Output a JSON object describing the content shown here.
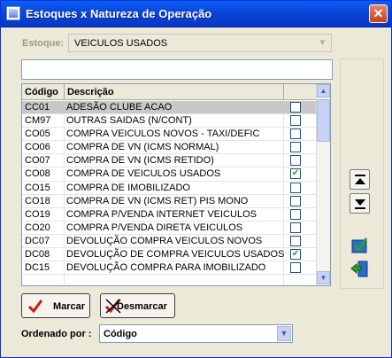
{
  "window": {
    "title": "Estoques x Natureza de Operação",
    "close_label": "✕"
  },
  "estoque": {
    "label": "Estoque:",
    "value": "VEICULOS USADOS"
  },
  "filter": {
    "value": ""
  },
  "grid": {
    "headers": [
      "Código",
      "Descrição"
    ],
    "rows": [
      {
        "code": "CC01",
        "desc": "ADESÃO CLUBE ACAO",
        "checked": false,
        "selected": true
      },
      {
        "code": "CM97",
        "desc": "OUTRAS SAIDAS (N/CONT)",
        "checked": false
      },
      {
        "code": "CO05",
        "desc": "COMPRA  VEICULOS NOVOS - TAXI/DEFIC",
        "checked": false
      },
      {
        "code": "CO06",
        "desc": "COMPRA DE VN (ICMS NORMAL)",
        "checked": false
      },
      {
        "code": "CO07",
        "desc": "COMPRA DE VN (ICMS RETIDO)",
        "checked": false
      },
      {
        "code": "CO08",
        "desc": "COMPRA DE VEICULOS USADOS",
        "checked": true
      },
      {
        "code": "CO15",
        "desc": "COMPRA DE IMOBILIZADO",
        "checked": false
      },
      {
        "code": "CO18",
        "desc": "COMPRA DE VN (ICMS RET) PIS MONO",
        "checked": false
      },
      {
        "code": "CO19",
        "desc": "COMPRA P/VENDA INTERNET VEICULOS",
        "checked": false
      },
      {
        "code": "CO20",
        "desc": "COMPRA P/VENDA DIRETA VEICULOS",
        "checked": false
      },
      {
        "code": "DC07",
        "desc": "DEVOLUÇÃO COMPRA VEICULOS NOVOS",
        "checked": false
      },
      {
        "code": "DC08",
        "desc": "DEVOLUÇÃO DE COMPRA VEICULOS USADOS",
        "checked": true
      },
      {
        "code": "DC15",
        "desc": "DEVOLUÇÃO COMPRA PARA IMOBILIZADO",
        "checked": false
      }
    ]
  },
  "buttons": {
    "marcar_label": "Marcar",
    "desmarcar_label": "Desmarcar"
  },
  "order": {
    "label": "Ordenado por :",
    "value": "Código"
  },
  "colors": {
    "titlebar": "#0a45d8",
    "check": "#21a121",
    "selected_row": "#c8c8c8"
  }
}
